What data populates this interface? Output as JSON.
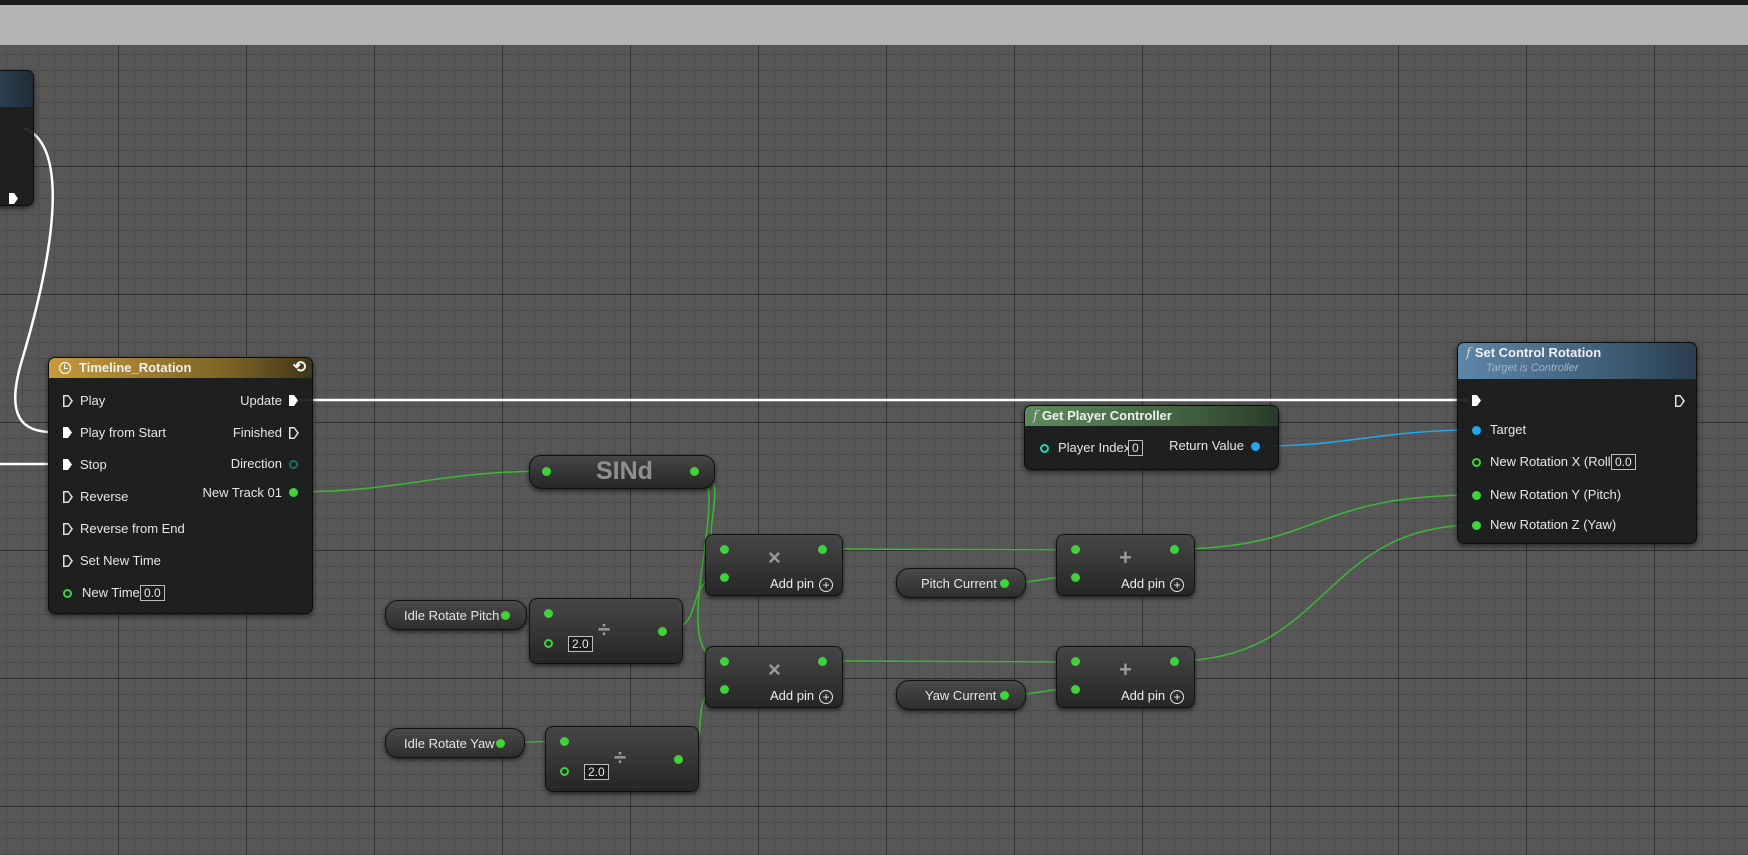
{
  "timeline": {
    "title": "Timeline_Rotation",
    "inputs": [
      "Play",
      "Play from Start",
      "Stop",
      "Reverse",
      "Reverse from End",
      "Set New Time"
    ],
    "new_time_label": "New Time",
    "new_time_value": "0.0",
    "outputs": [
      "Update",
      "Finished",
      "Direction",
      "New Track 01"
    ]
  },
  "sin_node": {
    "label": "SINd"
  },
  "get_player_controller": {
    "title": "Get Player Controller",
    "player_index_label": "Player Index",
    "player_index_value": "0",
    "return_value_label": "Return Value"
  },
  "set_control_rotation": {
    "title": "Set Control Rotation",
    "subtitle": "Target is Controller",
    "target_label": "Target",
    "roll_label": "New Rotation X (Roll)",
    "roll_value": "0.0",
    "pitch_label": "New Rotation Y (Pitch)",
    "yaw_label": "New Rotation Z (Yaw)"
  },
  "variables": {
    "idle_rotate_pitch": "Idle Rotate Pitch",
    "idle_rotate_yaw": "Idle Rotate Yaw",
    "pitch_current": "Pitch Current",
    "yaw_current": "Yaw Current"
  },
  "operators": {
    "multiply_symbol": "×",
    "add_symbol": "+",
    "divide_symbol": "÷",
    "add_pin_label": "Add pin",
    "divide_pitch_value": "2.0",
    "divide_yaw_value": "2.0"
  },
  "icons": {
    "function": "function-icon",
    "timeline": "clock-icon",
    "loop": "loop-icon",
    "add_pin": "circle-plus-icon"
  },
  "colors": {
    "exec_wire": "#ffffff",
    "float_wire": "#40d23a",
    "object_wire": "#23a7ee",
    "function_header": "#5d86a8",
    "pure_function_header": "#5e8a5d",
    "timeline_header": "#c69a3c"
  }
}
